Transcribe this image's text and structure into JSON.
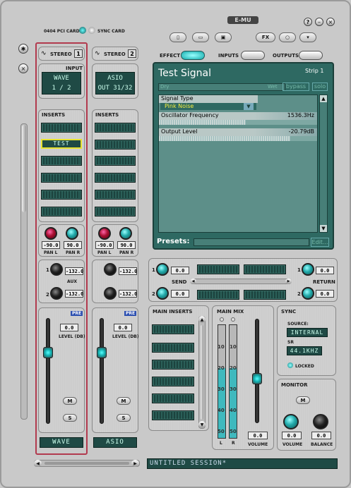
{
  "card": {
    "pci_label": "0404 PCI CARD",
    "sync_label": "SYNC CARD"
  },
  "brand": "E-MU",
  "toolbar": {
    "fx_label": "FX",
    "effect_label": "EFFECT",
    "inputs_label": "INPUTS",
    "outputs_label": "OUTPUTS"
  },
  "strip1": {
    "name": "STEREO",
    "number": "1",
    "input_label": "INPUT",
    "input_line1": "WAVE",
    "input_line2": "1 / 2",
    "inserts_label": "INSERTS",
    "insert_selected": "TEST",
    "pan_l_value": "-90.0",
    "pan_r_value": "90.0",
    "pan_l_label": "PAN L",
    "pan_r_label": "PAN R",
    "aux_label": "AUX",
    "aux1_num": "1",
    "aux2_num": "2",
    "aux1_value": "-132.0",
    "aux2_value": "-132.0",
    "pre_label": "PRE",
    "level_value": "0.0",
    "level_label": "LEVEL (DB)",
    "mute_label": "M",
    "solo_label": "S",
    "strip_name": "WAVE"
  },
  "strip2": {
    "name": "STEREO",
    "number": "2",
    "input_line1": "ASIO",
    "input_line2": "OUT 31/32",
    "inserts_label": "INSERTS",
    "pan_l_value": "-90.0",
    "pan_r_value": "90.0",
    "pan_l_label": "PAN L",
    "pan_r_label": "PAN R",
    "aux1_value": "-132.0",
    "aux2_value": "-132.0",
    "pre_label": "PRE",
    "level_value": "0.0",
    "level_label": "LEVEL (DB)",
    "mute_label": "M",
    "solo_label": "S",
    "strip_name": "ASIO"
  },
  "effect": {
    "title": "Test Signal",
    "strip": "Strip 1",
    "dry_label": "Dry",
    "wet_label": "Wet",
    "bypass_label": "bypass",
    "solo_label": "solo",
    "signal_type_label": "Signal Type",
    "signal_type_value": "Pink Noise",
    "osc_label": "Oscillator Frequency",
    "osc_value": "1536.3Hz",
    "output_label": "Output Level",
    "output_value": "-20.79dB",
    "osc_fraction": 0.55,
    "output_fraction": 0.83,
    "presets_label": "Presets:",
    "edit_label": "Edit..."
  },
  "send_return": {
    "send_label": "SEND",
    "return_label": "RETURN",
    "send1_num": "1",
    "send2_num": "2",
    "return1_num": "1",
    "return2_num": "2",
    "send1_value": "0.0",
    "send2_value": "0.0",
    "return1_value": "0.0",
    "return2_value": "0.0"
  },
  "main_inserts": {
    "label": "MAIN INSERTS"
  },
  "main_mix": {
    "label": "MAIN MIX",
    "scale": [
      "10",
      "20",
      "30",
      "40",
      "50"
    ],
    "l_label": "L",
    "r_label": "R",
    "volume_label": "VOLUME",
    "volume_value": "0.0",
    "meter_level": 0.62
  },
  "sync": {
    "label": "SYNC",
    "source_label": "SOURCE:",
    "source_value": "INTERNAL",
    "sr_label": "SR",
    "sr_value": "44.1KHZ",
    "locked_label": "LOCKED"
  },
  "monitor": {
    "label": "MONITOR",
    "mute_label": "M",
    "volume_value": "0.0",
    "balance_value": "0.0",
    "volume_label": "VOLUME",
    "balance_label": "BALANCE"
  },
  "session": {
    "name": "UNTITLED SESSION*"
  }
}
